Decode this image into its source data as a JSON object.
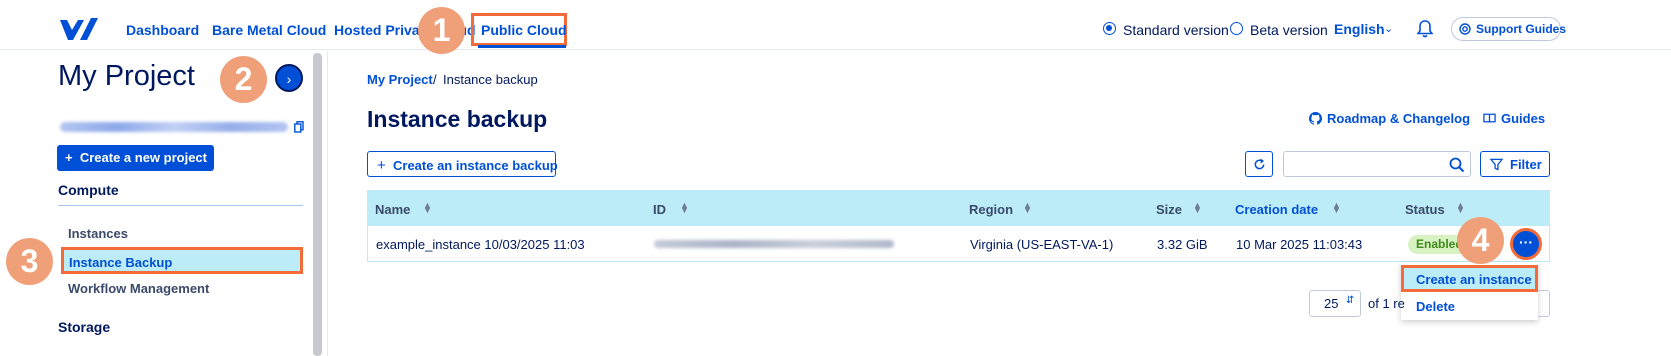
{
  "nav": {
    "items": [
      "Dashboard",
      "Bare Metal Cloud",
      "Hosted Private Cloud",
      "Public Cloud"
    ],
    "version_options": [
      "Standard version",
      "Beta version"
    ],
    "selected_version": "Standard version",
    "language": "English",
    "support_label": "Support Guides"
  },
  "sidebar": {
    "project_title": "My Project",
    "create_project_label": "Create a new project",
    "sections": [
      {
        "title": "Compute",
        "items": [
          "Instances",
          "Instance Backup",
          "Workflow Management"
        ],
        "active": "Instance Backup"
      },
      {
        "title": "Storage",
        "items": []
      }
    ]
  },
  "main": {
    "breadcrumb": {
      "root": "My Project",
      "separator": "/",
      "current": "Instance backup"
    },
    "title": "Instance backup",
    "roadmap_link": "Roadmap & Changelog",
    "guides_link": "Guides",
    "create_button": "Create an instance backup",
    "filter_button": "Filter",
    "table": {
      "columns": [
        "Name",
        "ID",
        "Region",
        "Size",
        "Creation date",
        "Status"
      ],
      "rows": [
        {
          "name": "example_instance 10/03/2025 11:03",
          "region": "Virginia (US-EAST-VA-1)",
          "size": "3.32 GiB",
          "creation_date": "10 Mar 2025 11:03:43",
          "status": "Enabled"
        }
      ]
    },
    "row_menu": {
      "items": [
        "Create an instance",
        "Delete"
      ]
    },
    "pagination": {
      "page_size": "25",
      "of_text": "of 1 re"
    }
  },
  "callouts": [
    "1",
    "2",
    "3",
    "4"
  ],
  "colors": {
    "accent": "#0050d7",
    "highlight": "#f26b38",
    "row_highlight": "#bcecf8",
    "callout": "#f0a078",
    "status_enabled": "#3b8a1a"
  }
}
